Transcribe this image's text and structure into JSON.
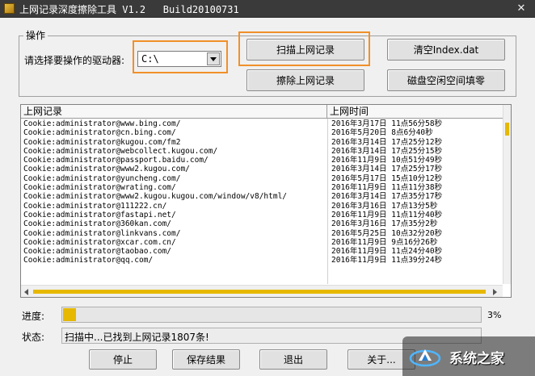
{
  "window": {
    "title": "上网记录深度擦除工具 V1.2   Build20100731",
    "close_glyph": "✕"
  },
  "operation": {
    "group_title": "操作",
    "drive_label": "请选择要操作的驱动器:",
    "drive_value": "C:\\"
  },
  "buttons": {
    "scan": "扫描上网记录",
    "erase": "擦除上网记录",
    "clear_index": "清空Index.dat",
    "disk_fill": "磁盘空闲空间填零",
    "stop": "停止",
    "save": "保存结果",
    "exit": "退出",
    "about": "关于..."
  },
  "list": {
    "columns": [
      "上网记录",
      "上网时间"
    ],
    "rows": [
      [
        "Cookie:administrator@www.bing.com/",
        "2016年3月17日  11点56分58秒"
      ],
      [
        "Cookie:administrator@cn.bing.com/",
        "2016年5月20日  8点6分40秒"
      ],
      [
        "Cookie:administrator@kugou.com/fm2",
        "2016年3月14日  17点25分12秒"
      ],
      [
        "Cookie:administrator@webcollect.kugou.com/",
        "2016年3月14日  17点25分15秒"
      ],
      [
        "Cookie:administrator@passport.baidu.com/",
        "2016年11月9日  10点51分49秒"
      ],
      [
        "Cookie:administrator@www2.kugou.com/",
        "2016年3月14日  17点25分17秒"
      ],
      [
        "Cookie:administrator@yuncheng.com/",
        "2016年5月17日  15点10分12秒"
      ],
      [
        "Cookie:administrator@wrating.com/",
        "2016年11月9日  11点11分38秒"
      ],
      [
        "Cookie:administrator@www2.kugou.kugou.com/window/v8/html/",
        "2016年3月14日  17点35分17秒"
      ],
      [
        "Cookie:administrator@111222.cn/",
        "2016年3月16日  17点13分5秒"
      ],
      [
        "Cookie:administrator@fastapi.net/",
        "2016年11月9日  11点11分40秒"
      ],
      [
        "Cookie:administrator@360kan.com/",
        "2016年3月16日  17点35分2秒"
      ],
      [
        "Cookie:administrator@linkvans.com/",
        "2016年5月25日  10点32分20秒"
      ],
      [
        "Cookie:administrator@xcar.com.cn/",
        "2016年11月9日  9点16分26秒"
      ],
      [
        "Cookie:administrator@taobao.com/",
        "2016年11月9日  11点24分40秒"
      ],
      [
        "Cookie:administrator@qq.com/",
        "2016年11月9日  11点39分24秒"
      ]
    ]
  },
  "progress": {
    "label": "进度:",
    "percent_text": "3%",
    "value": 0.03,
    "color": "#e6b800"
  },
  "status": {
    "label": "状态:",
    "text": "扫描中...已找到上网记录1807条!"
  },
  "watermark": {
    "text": "系统之家"
  },
  "colors": {
    "accent_highlight": "#f0902a",
    "scrollbar": "#e6b800"
  }
}
